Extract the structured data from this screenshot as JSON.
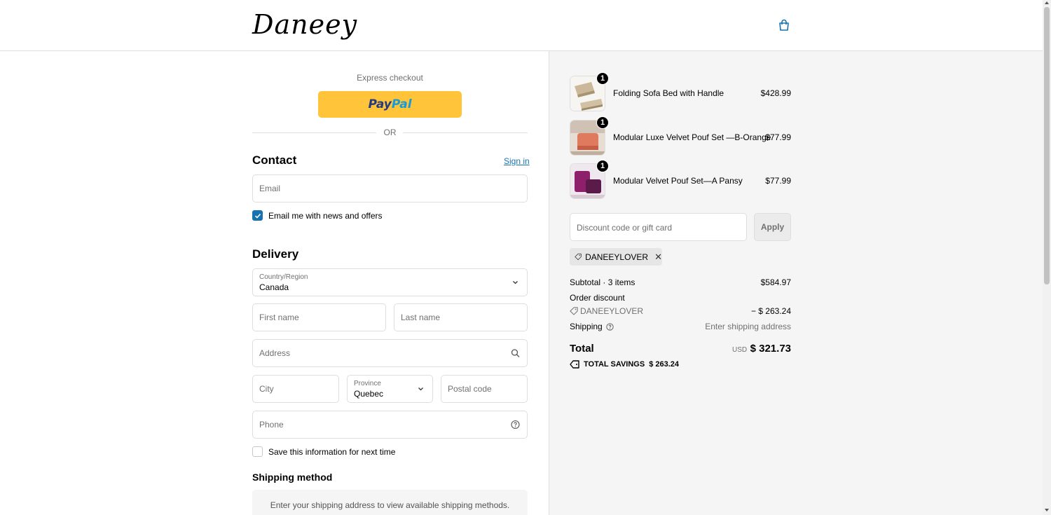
{
  "header": {
    "logo": "Daneey",
    "cart_icon": "shopping-bag-icon"
  },
  "express": {
    "title": "Express checkout",
    "paypal_part1": "Pay",
    "paypal_part2": "Pal",
    "or_label": "OR"
  },
  "contact": {
    "title": "Contact",
    "sign_in": "Sign in",
    "email_placeholder": "Email",
    "newsletter_label": "Email me with news and offers",
    "newsletter_checked": true
  },
  "delivery": {
    "title": "Delivery",
    "country_label": "Country/Region",
    "country_value": "Canada",
    "first_name_placeholder": "First name",
    "last_name_placeholder": "Last name",
    "address_placeholder": "Address",
    "city_placeholder": "City",
    "province_label": "Province",
    "province_value": "Quebec",
    "postal_placeholder": "Postal code",
    "phone_placeholder": "Phone",
    "save_info_label": "Save this information for next time",
    "save_info_checked": false
  },
  "shipping_method": {
    "title": "Shipping method",
    "note": "Enter your shipping address to view available shipping methods."
  },
  "cart": {
    "items": [
      {
        "name": "Folding Sofa Bed with Handle",
        "price": "$428.99",
        "qty": "1"
      },
      {
        "name": "Modular Luxe Velvet Pouf Set —B-Orange",
        "price": "$77.99",
        "qty": "1"
      },
      {
        "name": "Modular Velvet Pouf Set—A Pansy",
        "price": "$77.99",
        "qty": "1"
      }
    ],
    "discount_placeholder": "Discount code or gift card",
    "apply_label": "Apply",
    "applied_code": "DANEEYLOVER"
  },
  "summary": {
    "subtotal_label": "Subtotal · 3 items",
    "subtotal_value": "$584.97",
    "order_discount_label": "Order discount",
    "discount_code": "DANEEYLOVER",
    "discount_value": "− $ 263.24",
    "shipping_label": "Shipping",
    "shipping_value": "Enter shipping address",
    "total_label": "Total",
    "currency": "USD",
    "total_value": "$ 321.73",
    "savings_label": "TOTAL SAVINGS",
    "savings_value": "$ 263.24"
  },
  "colors": {
    "accent": "#1773b0",
    "paypal": "#ffc439",
    "summary_bg": "#f5f5f5"
  }
}
